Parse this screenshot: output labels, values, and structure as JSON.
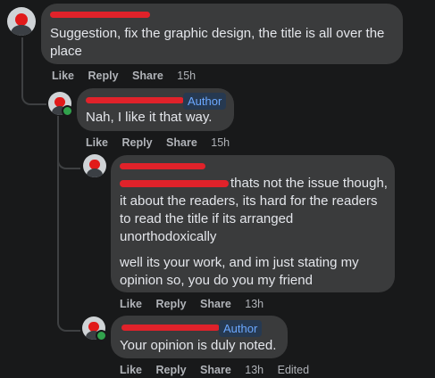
{
  "comments": [
    {
      "text": "Suggestion, fix the graphic design, the title is all over the place",
      "actions": {
        "like": "Like",
        "reply": "Reply",
        "share": "Share",
        "time": "15h"
      }
    },
    {
      "author_badge": "Author",
      "text": "Nah, I like it that way.",
      "actions": {
        "like": "Like",
        "reply": "Reply",
        "share": "Share",
        "time": "15h"
      }
    },
    {
      "text_para1": "thats not the issue though, it about the readers, its hard for the readers to read the title if its arranged unorthodoxically",
      "text_para2": "well its your work, and im just stating my opinion so, you do you my friend",
      "actions": {
        "like": "Like",
        "reply": "Reply",
        "share": "Share",
        "time": "13h"
      }
    },
    {
      "author_badge": "Author",
      "text": "Your opinion is duly noted.",
      "actions": {
        "like": "Like",
        "reply": "Reply",
        "share": "Share",
        "time": "13h",
        "edited": "Edited"
      }
    }
  ],
  "colors": {
    "background": "#18191a",
    "bubble": "#3a3b3c",
    "redaction": "#e0222a",
    "author_badge": "#6ca8ff",
    "online": "#31a24c"
  }
}
